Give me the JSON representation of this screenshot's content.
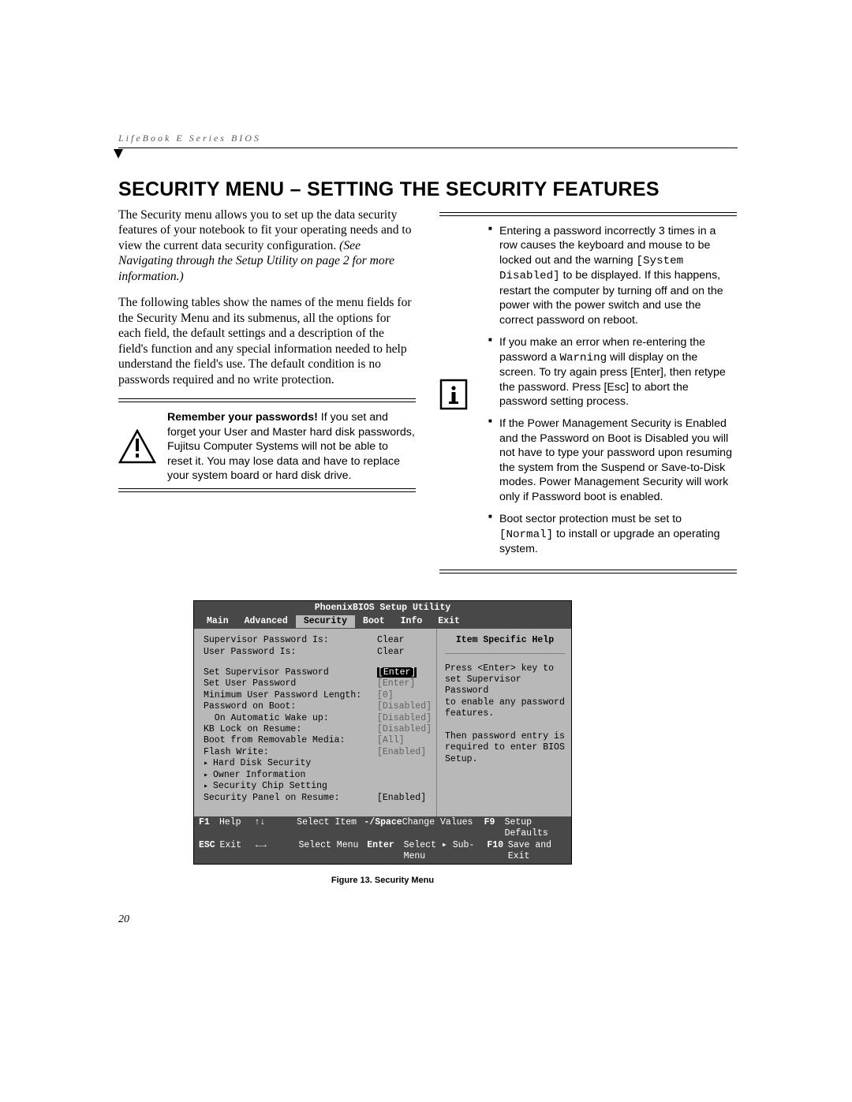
{
  "running_head": "LifeBook E Series BIOS",
  "heading": "SECURITY MENU – SETTING THE SECURITY FEATURES",
  "left": {
    "p1a": "The Security menu allows you to set up the data security features of your notebook to fit your operating needs and to view the current data security configuration. ",
    "p1b": "(See Navigating through the Setup Utility on page 2 for more information.)",
    "p2": "The following tables show the names of the menu fields for the Security Menu and its submenus, all the options for each field, the default settings and a description of the field's function and any special information needed to help understand the field's use. The default condition is no passwords required and no write protection.",
    "note_b": "Remember your passwords!",
    "note": " If you set and forget your User and Master hard disk passwords, Fujitsu Computer Systems will not be able to reset it. You may lose data and have to replace your system board or hard disk drive."
  },
  "right": {
    "b1a": "Entering a password incorrectly 3 times in a row causes the keyboard and mouse to be locked out and the warning ",
    "b1m": "[System Disabled]",
    "b1b": " to be displayed. If this happens, restart the computer by turning off and on the power with the power switch and use the correct password on reboot.",
    "b2a": "If you make an error when re-entering the password a ",
    "b2m": "Warning",
    "b2b": " will display on the screen. To try again press [Enter], then retype the password. Press [Esc] to abort the password setting process.",
    "b3": "If the Power Management Security is Enabled and the Password on Boot is Disabled you will not have to type your password upon resuming the system from the Suspend or Save-to-Disk modes. Power Management Security will work only if Password boot is enabled.",
    "b4a": "Boot sector protection must be set to ",
    "b4m": "[Normal]",
    "b4b": " to install or upgrade an operating system."
  },
  "bios": {
    "title": "PhoenixBIOS Setup Utility",
    "tabs": [
      "Main",
      "Advanced",
      "Security",
      "Boot",
      "Info",
      "Exit"
    ],
    "active_tab": 2,
    "fields": [
      {
        "label": "Supervisor Password Is:",
        "value": "Clear",
        "cls": ""
      },
      {
        "label": "User Password Is:",
        "value": "Clear",
        "cls": ""
      },
      {
        "gap": true
      },
      {
        "label": "Set Supervisor Password",
        "value": "[Enter]",
        "cls": "sel"
      },
      {
        "label": "Set User Password",
        "value": "[Enter]",
        "cls": "dim"
      },
      {
        "label": "Minimum User Password Length:",
        "value": "[0]",
        "cls": "dim"
      },
      {
        "label": "Password on Boot:",
        "value": "[Disabled]",
        "cls": "dim"
      },
      {
        "label": "  On Automatic Wake up:",
        "value": "[Disabled]",
        "cls": "dim"
      },
      {
        "label": "KB Lock on Resume:",
        "value": "[Disabled]",
        "cls": "dim"
      },
      {
        "label": "Boot from Removable Media:",
        "value": "[All]",
        "cls": "dim"
      },
      {
        "label": "Flash Write:",
        "value": "[Enabled]",
        "cls": "dim"
      },
      {
        "label": "Hard Disk Security",
        "value": "",
        "cls": "caret"
      },
      {
        "label": "Owner Information",
        "value": "",
        "cls": "caret"
      },
      {
        "label": "Security Chip Setting",
        "value": "",
        "cls": "caret"
      },
      {
        "label": "Security Panel on Resume:",
        "value": "[Enabled]",
        "cls": ""
      }
    ],
    "help_title": "Item Specific Help",
    "help_lines": [
      "Press <Enter> key to",
      "set Supervisor Password",
      "to enable any password",
      "features.",
      "",
      "Then password entry is",
      "required to enter BIOS",
      "Setup."
    ],
    "keys": {
      "r1": [
        [
          "F1",
          "Help"
        ],
        [
          "↑↓",
          "Select Item"
        ],
        [
          "-/Space",
          "Change Values"
        ],
        [
          "F9",
          "Setup Defaults"
        ]
      ],
      "r2": [
        [
          "ESC",
          "Exit"
        ],
        [
          "←→",
          "Select Menu"
        ],
        [
          "Enter",
          "Select ▸ Sub-Menu"
        ],
        [
          "F10",
          "Save and Exit"
        ]
      ]
    }
  },
  "caption": "Figure 13.  Security Menu",
  "page_num": "20"
}
